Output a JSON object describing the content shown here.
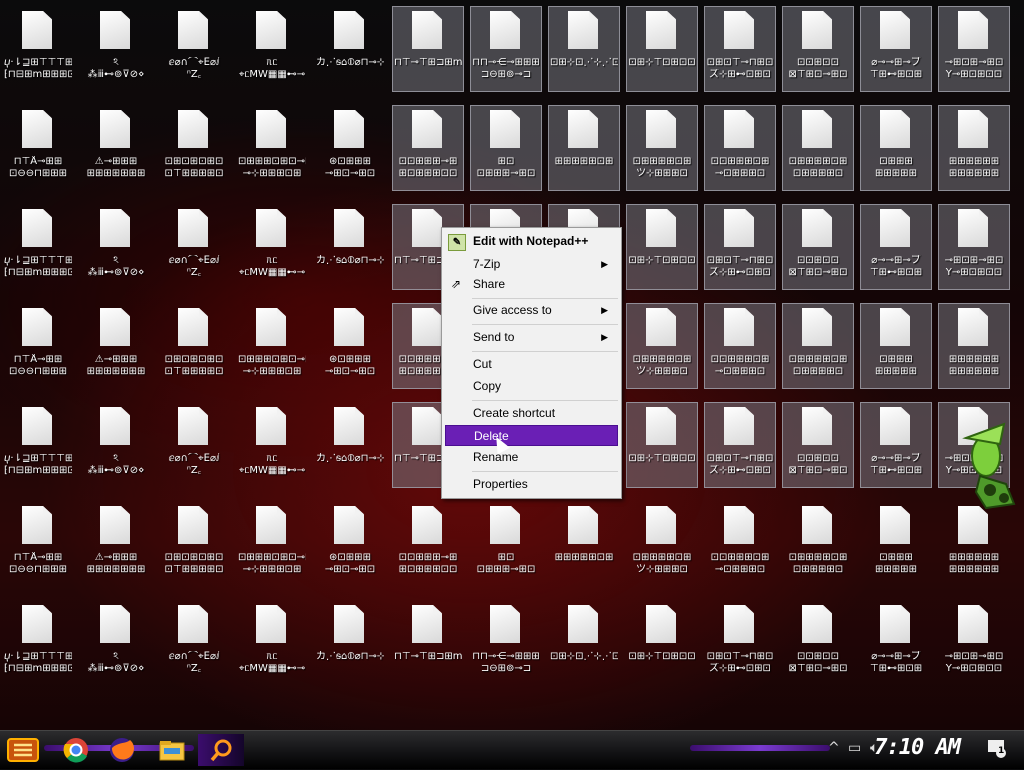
{
  "desktop": {
    "icons": [
      {
        "l1": "ⴤ·⇂⊒⊞⊤⊤⊤⊞⊐",
        "l2": "⁅⊓⊟⊞ⅿ⊞⊞⊞⊡⊡",
        "selected": false
      },
      {
        "l1": "ঽ",
        "l2": "⁂ⅲ⊷⊚⊽⊘⋄",
        "selected": false
      },
      {
        "l1": "ⅇ⌀∩⌒⌖ⴹ⌀ⅈ",
        "l2": "ⁿΖ꜀",
        "selected": false
      },
      {
        "l1": "ᥰᥴ",
        "l2": "⌖ᥴMW▦▦⊷⊸",
        "selected": false
      },
      {
        "l1": "カ⋰ᵴ⌂⦶⌀⊓⊸⊹",
        "l2": "",
        "selected": false
      },
      {
        "l1": "⊓⊤⊸⊤⊞⊐⊞ⅿ⊞",
        "l2": "",
        "selected": true
      },
      {
        "l1": "⊓⊓⊸⋲⊸⊞⊞⊞",
        "l2": "⊐⊖⊞⊚⊸⊐",
        "selected": true
      },
      {
        "l1": "⊡⊞⊹⊡⋰⊹⋰⊡",
        "l2": "",
        "selected": true
      },
      {
        "l1": "⊡⊞⊹⊤⊡⊞⊡⊡",
        "l2": "",
        "selected": true
      },
      {
        "l1": "⊡⊞⊡⊤⊸⊓⊞⊡",
        "l2": "ズ⊹⊞⊷⊡⊞⊡",
        "selected": true
      },
      {
        "l1": "⊡⊡⊞⊡⊡",
        "l2": "⊠⊤⊞⊡⊸⊞⊡",
        "selected": true
      },
      {
        "l1": "⌀⊸⊸⊞⊸ブ",
        "l2": "⊤⊞⊷⊞⊡⊞",
        "selected": true
      },
      {
        "l1": "⊸⊞⊡⊞⊸⊞⊡",
        "l2": "Y⊸⊞⊡⊞⊡⊡",
        "selected": true
      },
      {
        "l1": "⊓⊤Å⊸⊞⊞",
        "l2": "⊡⊖⊖⊓⊞⊞⊞",
        "selected": false
      },
      {
        "l1": "⚠⊸⊞⊞⊞",
        "l2": "⊞⊞⊞⊞⊞⊞⊞",
        "selected": false
      },
      {
        "l1": "⊡⊞⊡⊞⊡⊞⊡",
        "l2": "⊡⊤⊞⊞⊞⊞⊡",
        "selected": false
      },
      {
        "l1": "⊡⊞⊞⊞⊡⊞⊡⊸⊞",
        "l2": "⊸⊹⊞⊞⊞⊡⊞",
        "selected": false
      },
      {
        "l1": "⊛⊡⊞⊞⊞",
        "l2": "⊸⊞⊡⊸⊞⊡",
        "selected": false
      },
      {
        "l1": "⊡⊡⊞⊞⊞⊸⊞",
        "l2": "⊞⊡⊞⊞⊞⊡⊡",
        "selected": true
      },
      {
        "l1": "⊞⊡",
        "l2": "⊡⊞⊞⊞⊸⊞⊡",
        "selected": true
      },
      {
        "l1": "⊞⊞⊞⊞⊞⊡⊞",
        "l2": "",
        "selected": true
      },
      {
        "l1": "⊡⊞⊞⊞⊞⊡⊞",
        "l2": "ツ⊹⊞⊞⊞⊡",
        "selected": true
      },
      {
        "l1": "⊡⊡⊞⊞⊞⊡⊞",
        "l2": "⊸⊡⊞⊞⊞⊡",
        "selected": true
      },
      {
        "l1": "⊡⊞⊞⊞⊞⊡⊞",
        "l2": "⊡⊞⊞⊞⊞⊡",
        "selected": true
      },
      {
        "l1": "⊡⊞⊞⊞",
        "l2": "⊞⊞⊞⊞⊞",
        "selected": true
      },
      {
        "l1": "⊞⊞⊞⊞⊞⊞",
        "l2": "⊞⊞⊞⊞⊞⊞",
        "selected": true
      }
    ]
  },
  "context_menu": {
    "items": [
      {
        "label": "Edit with Notepad++",
        "bold": true,
        "icon": "notepad-icon",
        "submenu": false
      },
      {
        "label": "7-Zip",
        "bold": false,
        "icon": "",
        "submenu": true
      },
      {
        "label": "Share",
        "bold": false,
        "icon": "share-icon",
        "submenu": false
      },
      {
        "label": "Give access to",
        "bold": false,
        "icon": "",
        "submenu": true
      },
      {
        "label": "Send to",
        "bold": false,
        "icon": "",
        "submenu": true
      },
      {
        "label": "Cut",
        "bold": false,
        "icon": "",
        "submenu": false
      },
      {
        "label": "Copy",
        "bold": false,
        "icon": "",
        "submenu": false
      },
      {
        "label": "Create shortcut",
        "bold": false,
        "icon": "",
        "submenu": false
      },
      {
        "label": "Delete",
        "bold": false,
        "icon": "",
        "submenu": false,
        "highlighted": true
      },
      {
        "label": "Rename",
        "bold": false,
        "icon": "",
        "submenu": false
      },
      {
        "label": "Properties",
        "bold": false,
        "icon": "",
        "submenu": false
      }
    ]
  },
  "taskbar": {
    "pinned": [
      "start-icon",
      "chrome-icon",
      "firefox-icon",
      "file-explorer-icon",
      "search-icon"
    ],
    "clock": "7:10 AM",
    "notification_count": "1",
    "accent": "#6a1fb5"
  }
}
